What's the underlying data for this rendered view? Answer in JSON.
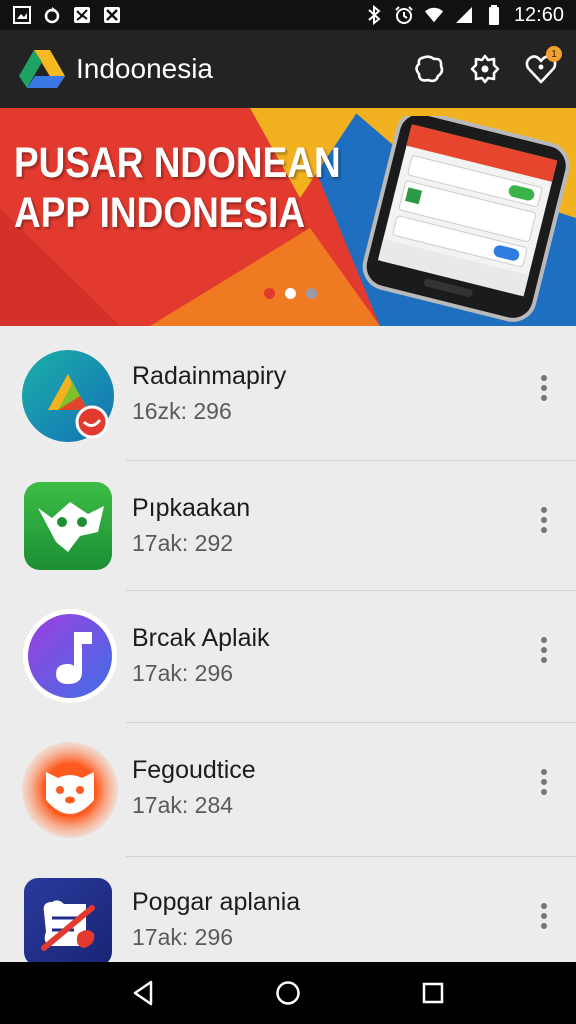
{
  "status_bar": {
    "time": "12:60",
    "left_icons": [
      "gallery-notification-icon",
      "sync-notification-icon",
      "image-notification-icon",
      "photo-notification-icon"
    ],
    "right_icons": [
      "bluetooth-icon",
      "alarm-icon",
      "wifi-icon",
      "signal-icon",
      "battery-icon"
    ]
  },
  "app_bar": {
    "title": "Indoonesia",
    "logo_icon": "triangle-logo-icon",
    "actions": [
      "chat-icon",
      "settings-icon",
      "favorites-icon"
    ],
    "favorites_badge": "1"
  },
  "banner": {
    "line1": "PUSAR NDONEAN",
    "line2": "APP INDONESIA",
    "carousel_page": 2,
    "carousel_count": 3,
    "colors": [
      "#e23a2f",
      "#1f6fc1",
      "#f2b21f"
    ]
  },
  "apps": [
    {
      "name": "Radainmapiry",
      "meta": "16zk: 296",
      "icon": "green-triangle-app-icon"
    },
    {
      "name": "Pıpkaakan",
      "meta": "17ak: 292",
      "icon": "green-face-app-icon"
    },
    {
      "name": "Brcak Aplaik",
      "meta": "17ak: 296",
      "icon": "music-note-app-icon"
    },
    {
      "name": "Fegoudtice",
      "meta": "17ak: 284",
      "icon": "orange-cat-app-icon"
    },
    {
      "name": "Popgar aplania",
      "meta": "17ak: 296",
      "icon": "blue-cancel-app-icon"
    }
  ],
  "nav_bar": {
    "buttons": [
      "back-icon",
      "home-icon",
      "recents-icon"
    ]
  }
}
